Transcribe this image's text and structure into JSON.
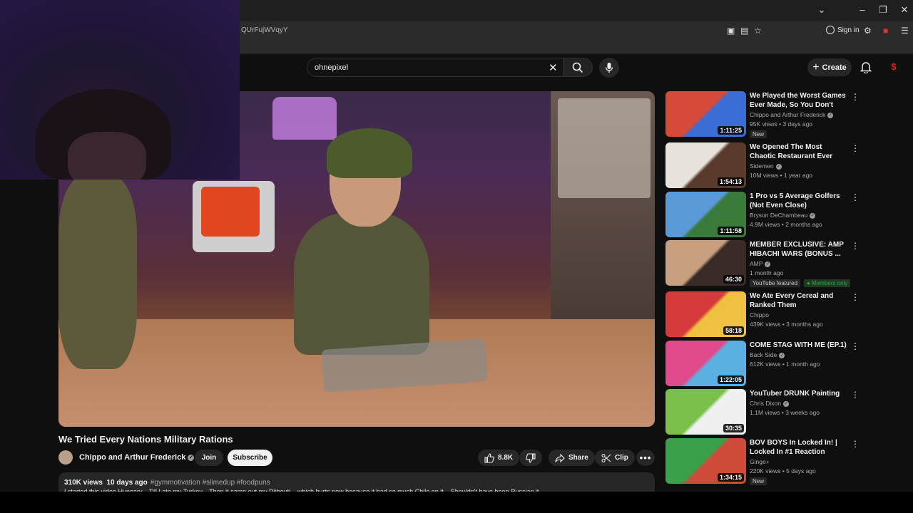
{
  "browser": {
    "url_fragment": "QUrFujWVqyY",
    "sign_in": "Sign in"
  },
  "header": {
    "search_value": "ohnepixel",
    "create_label": "Create"
  },
  "video": {
    "title": "We Tried Every Nations Military Rations",
    "channel": "Chippo and Arthur Frederick",
    "join_label": "Join",
    "subscribe_label": "Subscribe",
    "likes": "8.8K",
    "share_label": "Share",
    "clip_label": "Clip",
    "views": "310K views",
    "age": "10 days ago",
    "hashtags": "#gymmotivation #slimedup #foodpuns",
    "description": "I started this video Hungary... Till I ate my Turkey... Then it came out my Djibouti... which hurts now because it had so much Chile on it... Shouldn't have been Russian it..."
  },
  "recommendations": [
    {
      "title": "We Played the Worst Games Ever Made, So You Don't Have ...",
      "channel": "Chippo and Arthur Frederick",
      "verified": true,
      "meta": "95K views • 3 days ago",
      "duration": "1:11:25",
      "badge": "New",
      "badge2": "",
      "colors": [
        "#d64a3a",
        "#3a6ed6"
      ]
    },
    {
      "title": "We Opened The Most Chaotic Restaurant Ever",
      "channel": "Sidemen",
      "verified": true,
      "meta": "10M views • 1 year ago",
      "duration": "1:54:13",
      "badge": "",
      "badge2": "",
      "colors": [
        "#e8e2dc",
        "#5a3a2a"
      ]
    },
    {
      "title": "1 Pro vs 5 Average Golfers (Not Even Close)",
      "channel": "Bryson DeChambeau",
      "verified": true,
      "meta": "4.9M views • 2 months ago",
      "duration": "1:11:58",
      "badge": "",
      "badge2": "",
      "colors": [
        "#5a9ad6",
        "#3a7a3a"
      ]
    },
    {
      "title": "MEMBER EXCLUSIVE: AMP HIBACHI WARS (BONUS ...",
      "channel": "AMP",
      "verified": true,
      "meta": "1 month ago",
      "duration": "46:30",
      "badge": "YouTube featured",
      "badge2": "Members only",
      "colors": [
        "#c8a080",
        "#3a2a28"
      ]
    },
    {
      "title": "We Ate Every Cereal and Ranked Them",
      "channel": "Chippo",
      "verified": false,
      "meta": "439K views • 3 months ago",
      "duration": "58:18",
      "badge": "",
      "badge2": "",
      "colors": [
        "#d63a3a",
        "#f0c040"
      ]
    },
    {
      "title": "COME STAG WITH ME (EP.1)",
      "channel": "Back Side",
      "verified": true,
      "meta": "612K views • 1 month ago",
      "duration": "1:22:05",
      "badge": "",
      "badge2": "",
      "colors": [
        "#e04a8a",
        "#5ab0e0"
      ]
    },
    {
      "title": "YouTuber DRUNK Painting",
      "channel": "Chris Dixon",
      "verified": true,
      "meta": "1.1M views • 3 weeks ago",
      "duration": "30:35",
      "badge": "",
      "badge2": "",
      "colors": [
        "#7ac04a",
        "#f0f0f0"
      ]
    },
    {
      "title": "BOV BOYS In Locked In! | Locked In #1 Reaction",
      "channel": "Ginge+",
      "verified": false,
      "meta": "220K views • 5 days ago",
      "duration": "1:34:15",
      "badge": "New",
      "badge2": "",
      "colors": [
        "#3aa04a",
        "#d04a3a"
      ]
    }
  ]
}
